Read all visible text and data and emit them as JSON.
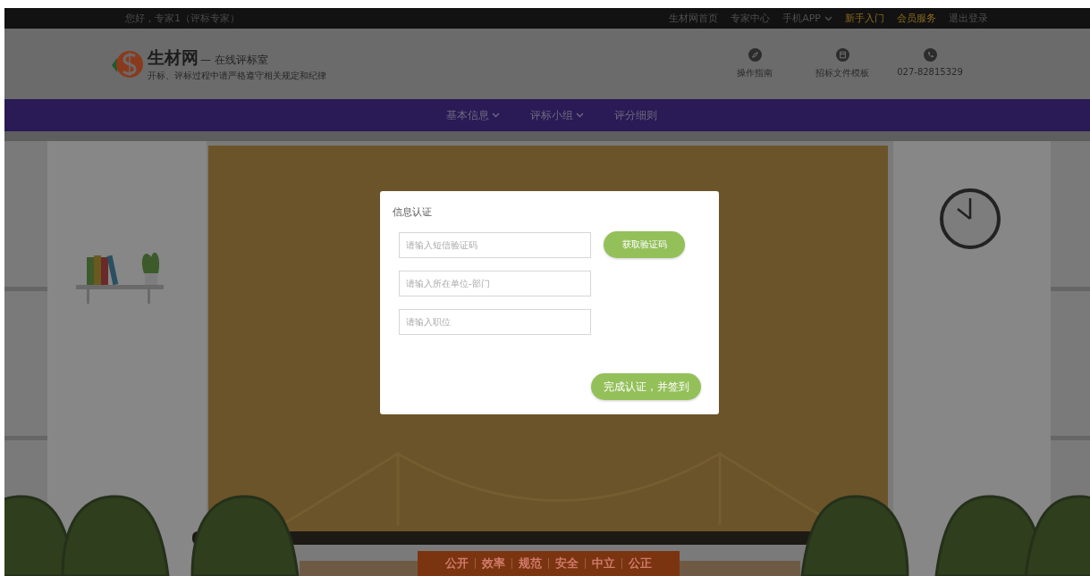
{
  "top_bar": {
    "greeting": "您好，专家1（评标专家）",
    "links": [
      {
        "label": "生材网首页",
        "kind": "link",
        "highlighted": false
      },
      {
        "label": "专家中心",
        "kind": "link",
        "highlighted": false
      },
      {
        "label": "手机APP",
        "kind": "dropdown",
        "highlighted": false
      },
      {
        "label": "新手入门",
        "kind": "link",
        "highlighted": true
      },
      {
        "label": "会员服务",
        "kind": "link",
        "highlighted": true
      },
      {
        "label": "退出登录",
        "kind": "link",
        "highlighted": false
      }
    ]
  },
  "header": {
    "brand": "生材网",
    "brand_suffix": "— 在线评标室",
    "slogan": "开标、评标过程中请严格遵守相关规定和纪律",
    "tools": [
      {
        "label": "操作指南",
        "kind": "compass"
      },
      {
        "label": "招标文件模板",
        "kind": "document"
      },
      {
        "label": "027-82815329",
        "kind": "phone"
      }
    ]
  },
  "nav": {
    "items": [
      {
        "label": "基本信息",
        "dropdown": true
      },
      {
        "label": "评标小组",
        "dropdown": true
      },
      {
        "label": "评分细则",
        "dropdown": false
      }
    ]
  },
  "dialog": {
    "title": "信息认证",
    "fields": [
      {
        "placeholder": "请输入短信验证码"
      },
      {
        "placeholder": "请输入所在单位-部门"
      },
      {
        "placeholder": "请输入职位"
      }
    ],
    "code_button": "获取验证码",
    "submit_button": "完成认证，并签到"
  },
  "banner": {
    "words": [
      "公开",
      "效率",
      "规范",
      "安全",
      "中立",
      "公正"
    ]
  }
}
